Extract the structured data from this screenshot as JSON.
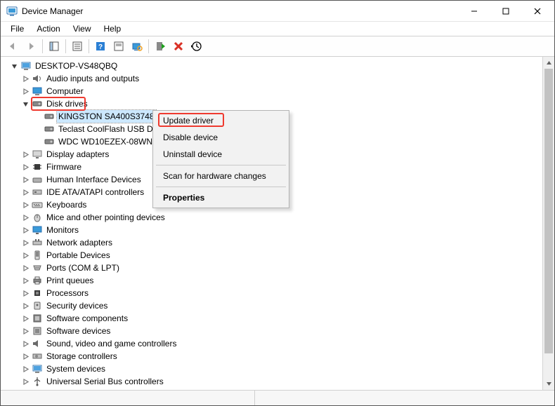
{
  "window": {
    "title": "Device Manager"
  },
  "menubar": {
    "file": "File",
    "action": "Action",
    "view": "View",
    "help": "Help"
  },
  "tree": {
    "root": "DESKTOP-VS48QBQ",
    "items": [
      {
        "label": "Audio inputs and outputs"
      },
      {
        "label": "Computer"
      },
      {
        "label": "Disk drives",
        "children": [
          {
            "label": "KINGSTON SA400S3748"
          },
          {
            "label": "Teclast CoolFlash USB D"
          },
          {
            "label": "WDC WD10EZEX-08WN"
          }
        ]
      },
      {
        "label": "Display adapters"
      },
      {
        "label": "Firmware"
      },
      {
        "label": "Human Interface Devices"
      },
      {
        "label": "IDE ATA/ATAPI controllers"
      },
      {
        "label": "Keyboards"
      },
      {
        "label": "Mice and other pointing devices"
      },
      {
        "label": "Monitors"
      },
      {
        "label": "Network adapters"
      },
      {
        "label": "Portable Devices"
      },
      {
        "label": "Ports (COM & LPT)"
      },
      {
        "label": "Print queues"
      },
      {
        "label": "Processors"
      },
      {
        "label": "Security devices"
      },
      {
        "label": "Software components"
      },
      {
        "label": "Software devices"
      },
      {
        "label": "Sound, video and game controllers"
      },
      {
        "label": "Storage controllers"
      },
      {
        "label": "System devices"
      },
      {
        "label": "Universal Serial Bus controllers"
      }
    ]
  },
  "context_menu": {
    "update_driver": "Update driver",
    "disable_device": "Disable device",
    "uninstall_device": "Uninstall device",
    "scan": "Scan for hardware changes",
    "properties": "Properties"
  }
}
